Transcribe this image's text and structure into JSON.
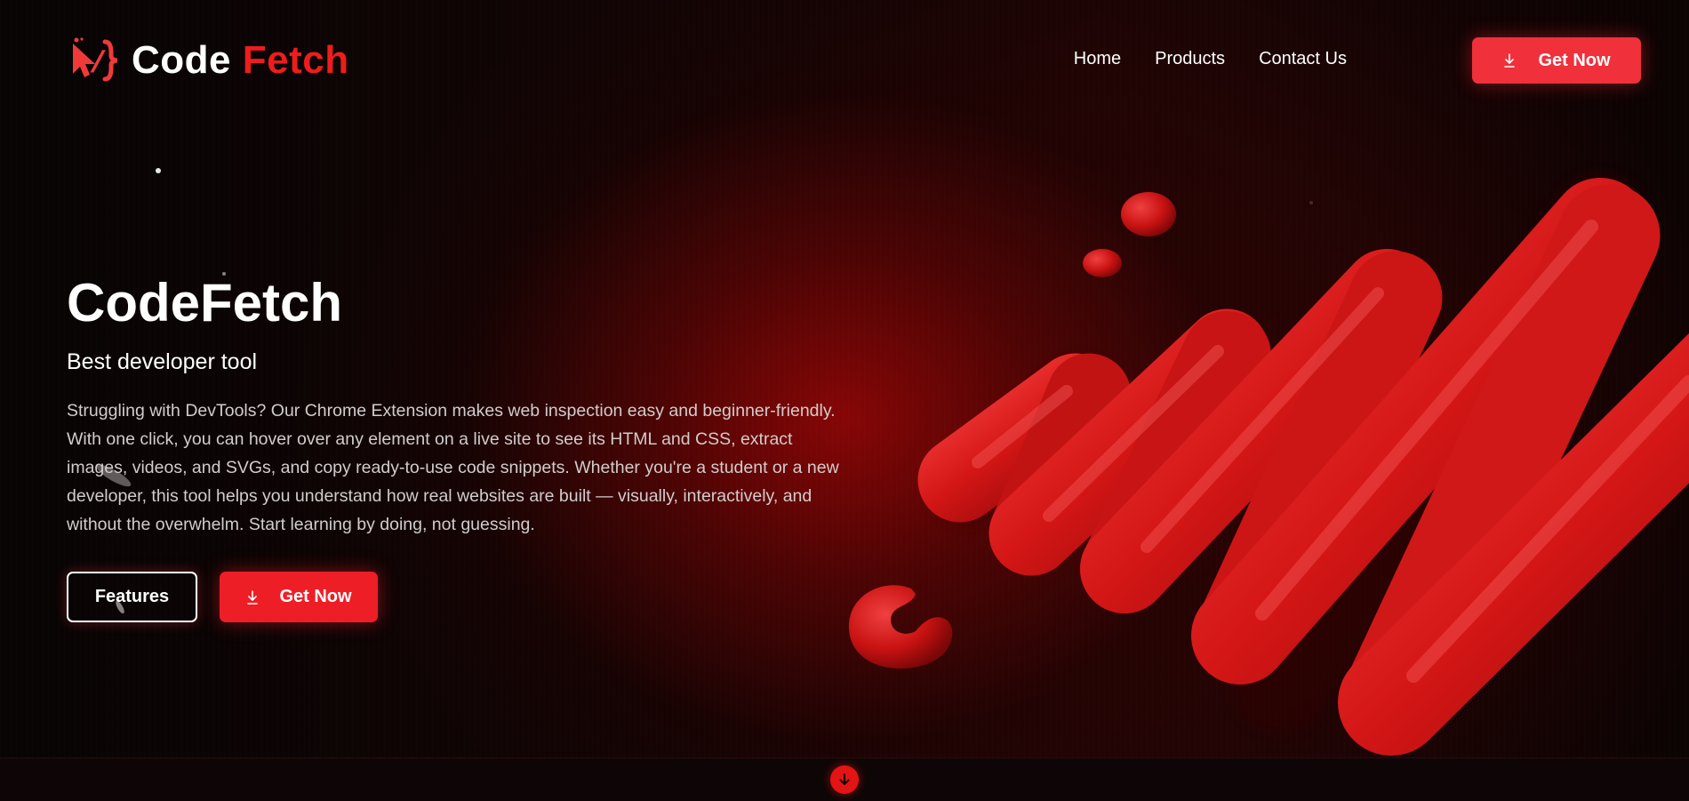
{
  "brand": {
    "name_part1": "Code",
    "name_part2": "Fetch",
    "logo_icon": "cursor-code-icon",
    "accent_color": "#ef1c1c"
  },
  "nav": {
    "items": [
      {
        "label": "Home"
      },
      {
        "label": "Products"
      },
      {
        "label": "Contact Us"
      }
    ],
    "cta_label": "Get Now",
    "cta_icon": "download-icon"
  },
  "hero": {
    "title": "CodeFetch",
    "subtitle": "Best developer tool",
    "description": "Struggling with DevTools? Our Chrome Extension makes web inspection easy and beginner-friendly. With one click, you can hover over any element on a live site to see its HTML and CSS, extract images, videos, and SVGs, and copy ready-to-use code snippets. Whether you're a student or a new developer, this tool helps you understand how real websites are built — visually, interactively, and without the overwhelm. Start learning by doing, not guessing.",
    "features_label": "Features",
    "cta_label": "Get Now",
    "cta_icon": "download-icon"
  },
  "footer_strip": {
    "scroll_icon": "arrow-down-circle-icon"
  },
  "colors": {
    "background": "#070303",
    "button_red": "#ee1e26",
    "text_muted": "#d2cccc"
  }
}
